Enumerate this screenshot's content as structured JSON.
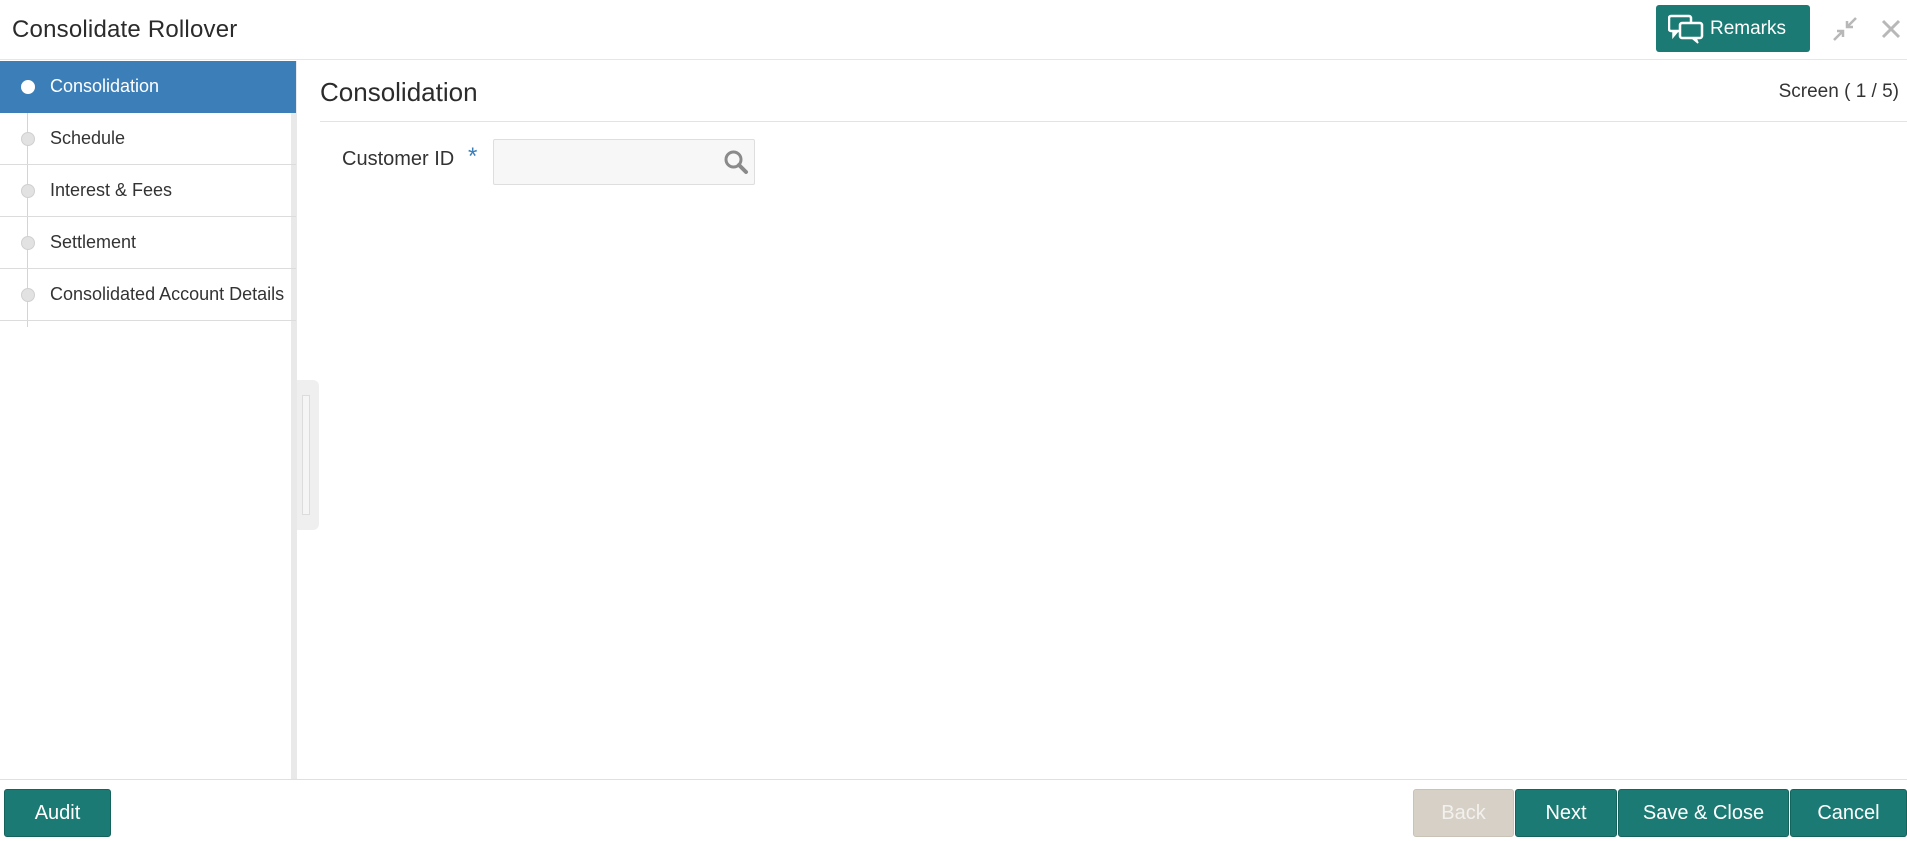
{
  "header": {
    "title": "Consolidate Rollover",
    "remarks_label": "Remarks"
  },
  "sidebar": {
    "items": [
      {
        "label": "Consolidation",
        "active": true
      },
      {
        "label": "Schedule",
        "active": false
      },
      {
        "label": "Interest & Fees",
        "active": false
      },
      {
        "label": "Settlement",
        "active": false
      },
      {
        "label": "Consolidated Account Details",
        "active": false
      }
    ]
  },
  "main": {
    "title": "Consolidation",
    "screen_counter": "Screen ( 1 / 5)",
    "customer_id": {
      "label": "Customer ID",
      "required_marker": "*",
      "value": "",
      "placeholder": ""
    }
  },
  "footer": {
    "audit_label": "Audit",
    "back_label": "Back",
    "next_label": "Next",
    "save_close_label": "Save & Close",
    "cancel_label": "Cancel"
  },
  "colors": {
    "accent_teal": "#1b7b74",
    "active_nav_blue": "#3c7fb8",
    "disabled_button": "#d6d0c6"
  }
}
